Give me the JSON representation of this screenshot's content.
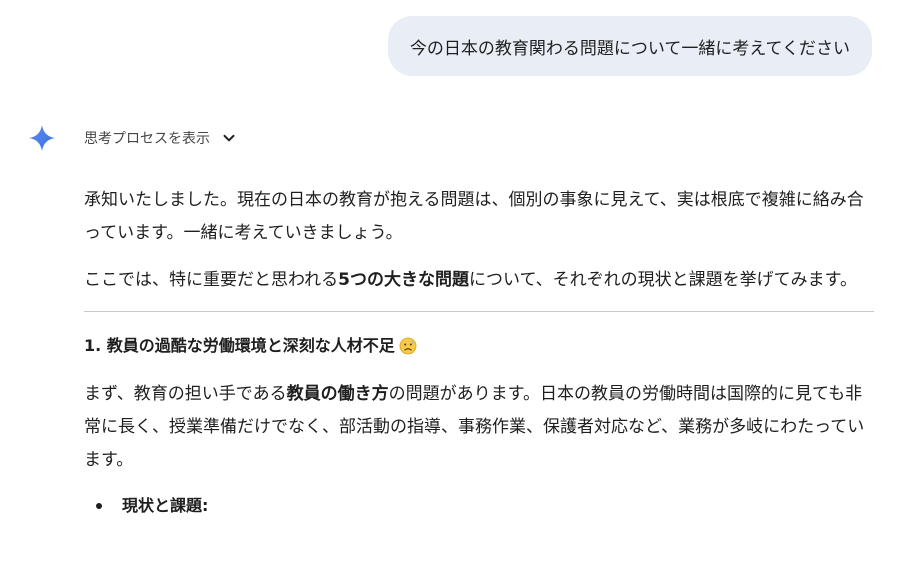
{
  "user_message": {
    "text": "今の日本の教育関わる問題について一緒に考えてください"
  },
  "thinking_toggle": {
    "label": "思考プロセスを表示",
    "icon": "chevron-down-icon"
  },
  "assistant_icon": "sparkle-icon",
  "response": {
    "p1": "承知いたしました。現在の日本の教育が抱える問題は、個別の事象に見えて、実は根底で複雑に絡み合っています。一緒に考えていきましょう。",
    "p2_before": "ここでは、特に重要だと思われる",
    "p2_bold": "5つの大きな問題",
    "p2_after": "について、それぞれの現状と課題を挙げてみます。",
    "section1_heading": "1. 教員の過酷な労働環境と深刻な人材不足",
    "section1_emoji": "sad-face-emoji",
    "p3_before": "まず、教育の担い手である",
    "p3_bold": "教員の働き方",
    "p3_after": "の問題があります。日本の教員の労働時間は国際的に見ても非常に長く、授業準備だけでなく、部活動の指導、事務作業、保護者対応など、業務が多岐にわたっています。",
    "bullet1": "現状と課題:"
  },
  "colors": {
    "user_bubble_bg": "#e9eef6",
    "text": "#1f1f1f",
    "muted_text": "#444746",
    "divider": "#c7c7c7",
    "sparkle_blue": "#4285f4"
  }
}
